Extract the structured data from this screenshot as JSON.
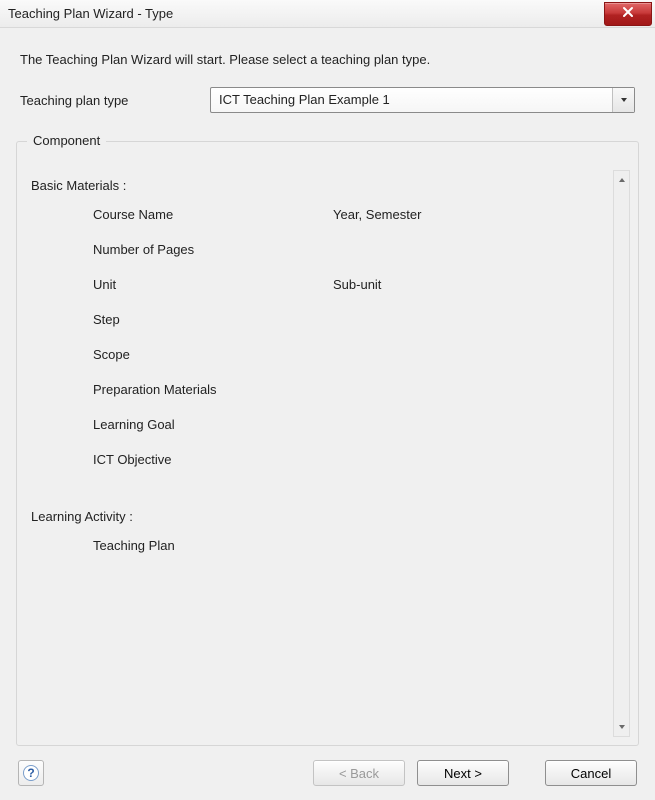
{
  "window": {
    "title": "Teaching Plan Wizard - Type"
  },
  "intro": "The Teaching Plan Wizard will start. Please select a teaching plan type.",
  "typeField": {
    "label": "Teaching plan type",
    "selected": "ICT Teaching Plan Example 1"
  },
  "componentBox": {
    "legend": "Component",
    "sections": {
      "basic": {
        "heading": "Basic Materials :",
        "rows": [
          {
            "left": "Course Name",
            "right": "Year, Semester"
          },
          {
            "left": "Number of Pages",
            "right": ""
          },
          {
            "left": "Unit",
            "right": "Sub-unit"
          },
          {
            "left": "Step",
            "right": ""
          },
          {
            "left": "Scope",
            "right": ""
          },
          {
            "left": "Preparation Materials",
            "right": ""
          },
          {
            "left": "Learning Goal",
            "right": ""
          },
          {
            "left": "ICT Objective",
            "right": ""
          }
        ]
      },
      "activity": {
        "heading": "Learning Activity :",
        "rows": [
          {
            "left": "Teaching Plan",
            "right": ""
          }
        ]
      }
    }
  },
  "buttons": {
    "back": "< Back",
    "next": "Next >",
    "cancel": "Cancel",
    "help": "?"
  }
}
